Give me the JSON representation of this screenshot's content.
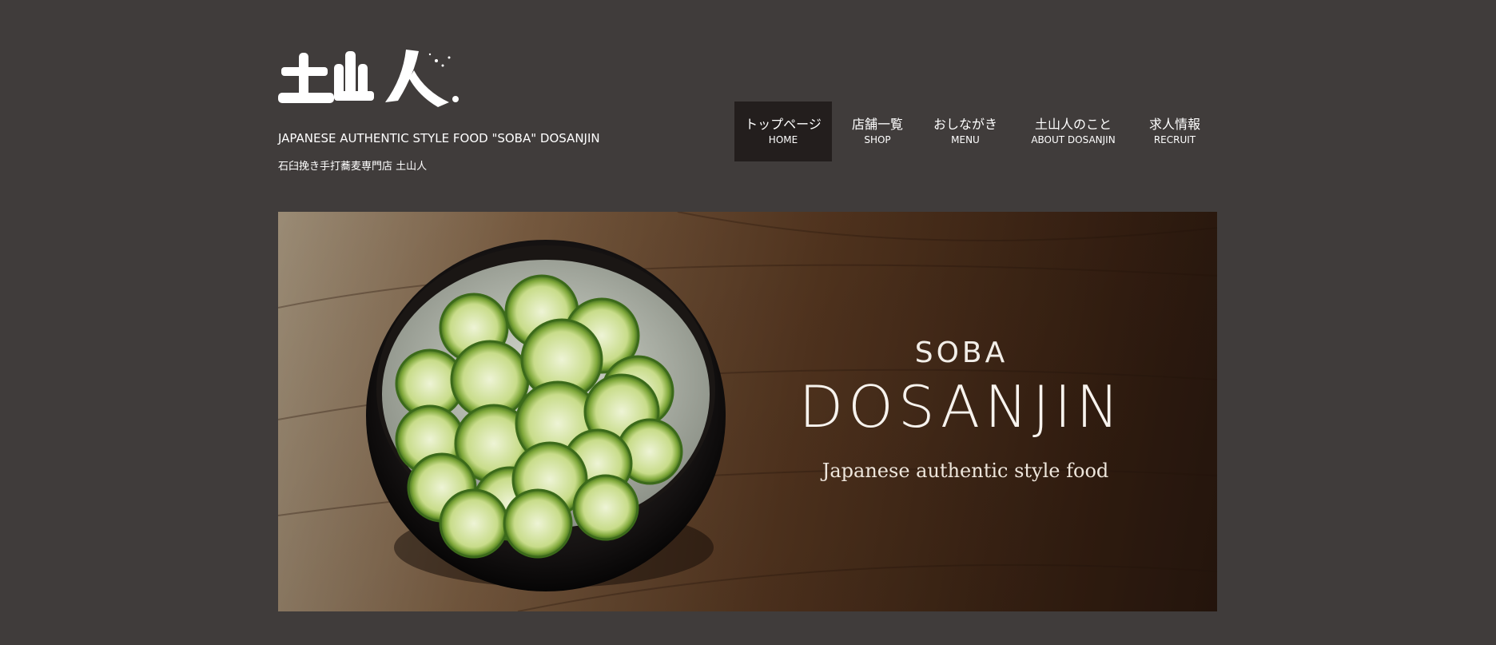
{
  "header": {
    "logo_text": "土山人",
    "tagline": "JAPANESE AUTHENTIC STYLE FOOD \"SOBA\" DOSANJIN",
    "subtitle": "石臼挽き手打蕎麦専門店 土山人"
  },
  "nav": {
    "items": [
      {
        "ja": "トップページ",
        "en": "HOME",
        "active": true
      },
      {
        "ja": "店舗一覧",
        "en": "SHOP",
        "active": false
      },
      {
        "ja": "おしながき",
        "en": "MENU",
        "active": false
      },
      {
        "ja": "土山人のこと",
        "en": "ABOUT DOSANJIN",
        "active": false
      },
      {
        "ja": "求人情報",
        "en": "RECRUIT",
        "active": false
      }
    ]
  },
  "hero": {
    "line1": "SOBA",
    "line2": "DOSANJIN",
    "line3": "Japanese authentic style food"
  },
  "colors": {
    "background": "#403c3b",
    "nav_active": "#231e1d",
    "text": "#ffffff"
  }
}
